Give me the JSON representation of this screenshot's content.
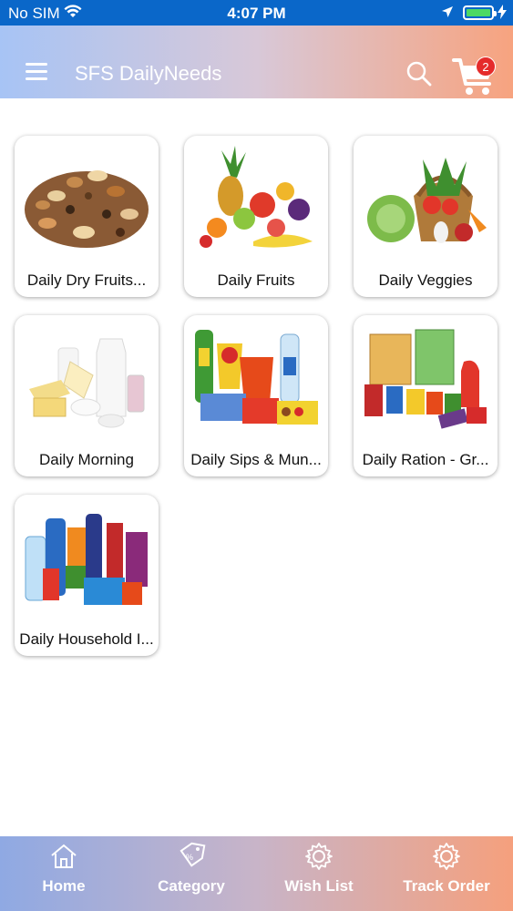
{
  "status_bar": {
    "carrier": "No SIM",
    "time": "4:07 PM"
  },
  "header": {
    "title": "SFS DailyNeeds",
    "cart_count": "2",
    "gradient_start": "#a7c4f5",
    "gradient_end": "#f7a37f"
  },
  "categories": [
    {
      "label": "Daily Dry Fruits...",
      "icon": "dry-fruits-image"
    },
    {
      "label": "Daily Fruits",
      "icon": "fruits-image"
    },
    {
      "label": "Daily Veggies",
      "icon": "veggies-image"
    },
    {
      "label": "Daily Morning",
      "icon": "dairy-image"
    },
    {
      "label": "Daily Sips & Mun...",
      "icon": "snacks-drinks-image"
    },
    {
      "label": "Daily Ration - Gr...",
      "icon": "grocery-image"
    },
    {
      "label": "Daily Household I...",
      "icon": "household-image"
    }
  ],
  "bottom_nav": [
    {
      "label": "Home",
      "icon": "home-icon"
    },
    {
      "label": "Category",
      "icon": "category-tag-icon"
    },
    {
      "label": "Wish List",
      "icon": "gear-icon"
    },
    {
      "label": "Track Order",
      "icon": "gear-icon"
    }
  ]
}
